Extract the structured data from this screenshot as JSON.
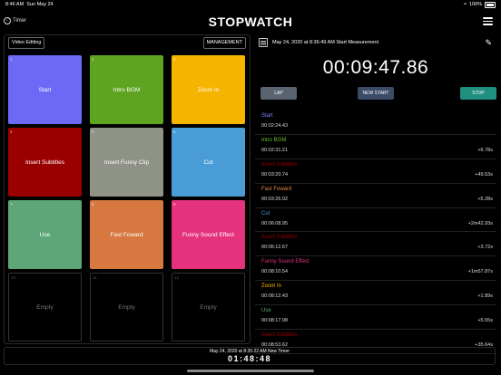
{
  "status_bar": {
    "time": "8:46 AM",
    "date": "Sun May 24",
    "battery": "100%"
  },
  "nav": {
    "back_label": "Timer",
    "title": "STOPWATCH"
  },
  "left": {
    "pill_left": "Video Editing",
    "pill_right": "MANAGEMENT",
    "tiles": [
      {
        "num": "1",
        "label": "Start",
        "color": "#6b69f5"
      },
      {
        "num": "2",
        "label": "Intro BGM",
        "color": "#5ea420"
      },
      {
        "num": "3",
        "label": "Zoom In",
        "color": "#f5b400"
      },
      {
        "num": "4",
        "label": "Insert Subtitles",
        "color": "#9b0000"
      },
      {
        "num": "5",
        "label": "Insert Funny Clip",
        "color": "#8f9287"
      },
      {
        "num": "6",
        "label": "Cut",
        "color": "#4a9cd6"
      },
      {
        "num": "7",
        "label": "Use",
        "color": "#5ea678"
      },
      {
        "num": "8",
        "label": "Fast Foward",
        "color": "#d6783f"
      },
      {
        "num": "9",
        "label": "Funny Sound Effect",
        "color": "#e5327c"
      },
      {
        "num": "10",
        "label": "Empty",
        "color": ""
      },
      {
        "num": "11",
        "label": "Empty",
        "color": ""
      },
      {
        "num": "12",
        "label": "Empty",
        "color": ""
      }
    ]
  },
  "right": {
    "header": "May 24, 2020 at 8:36:49 AM Start Measurement",
    "big_time": "00:09:47.86",
    "buttons": {
      "lap": "LAP",
      "new_start": "NEW START",
      "stop": "STOP"
    },
    "laps": [
      {
        "name": "Start",
        "color": "#7f7fff",
        "time": "00:02:24.43",
        "delta": ""
      },
      {
        "name": "Intro BGM",
        "color": "#6fbf2f",
        "time": "00:02:31.21",
        "delta": "+6.78s"
      },
      {
        "name": "Insert Subtitles",
        "color": "#9b0000",
        "time": "00:03:20.74",
        "delta": "+49.53s"
      },
      {
        "name": "Fast Foward",
        "color": "#e08a4b",
        "time": "00:03:26.02",
        "delta": "+5.28s"
      },
      {
        "name": "Cut",
        "color": "#4a9cd6",
        "time": "00:06:08.95",
        "delta": "+2m42.93s"
      },
      {
        "name": "Insert Subtitles",
        "color": "#9b0000",
        "time": "00:06:12.67",
        "delta": "+3.72s"
      },
      {
        "name": "Funny Sound Effect",
        "color": "#e5327c",
        "time": "00:08:10.54",
        "delta": "+1m57.87s"
      },
      {
        "name": "Zoom In",
        "color": "#f5b400",
        "time": "00:08:12.43",
        "delta": "+1.89s"
      },
      {
        "name": "Use",
        "color": "#5ea678",
        "time": "00:08:17.98",
        "delta": "+5.55s"
      },
      {
        "name": "Insert Subtitles",
        "color": "#9b0000",
        "time": "00:08:53.62",
        "delta": "+35.64s"
      }
    ]
  },
  "timer_bar": {
    "line1": "May 24, 2020 at 8:35:22 AM New Timer",
    "line2": "01:48:48"
  }
}
